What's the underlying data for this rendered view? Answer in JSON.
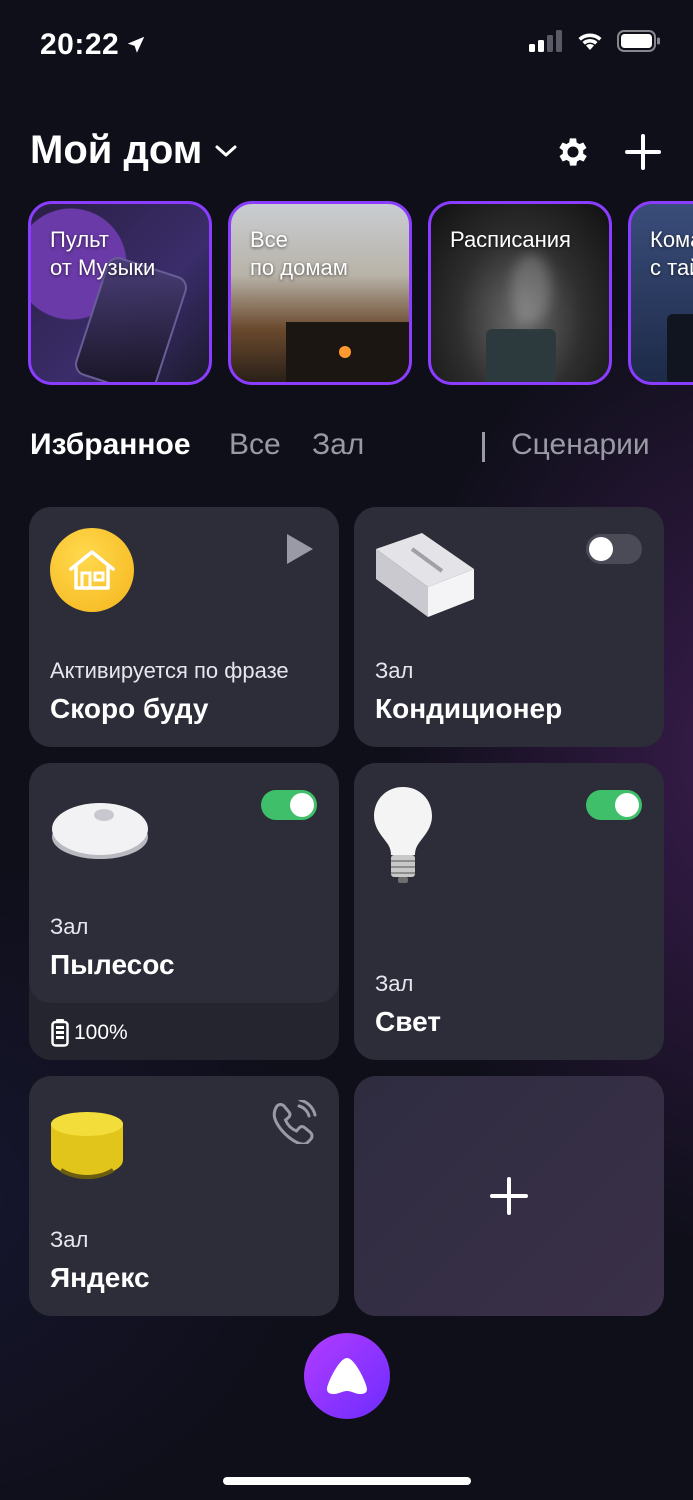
{
  "status_bar": {
    "time": "20:22"
  },
  "header": {
    "title": "Мой дом"
  },
  "stories": [
    {
      "label_line1": "Пульт",
      "label_line2": "от Музыки"
    },
    {
      "label_line1": "Все",
      "label_line2": "по домам"
    },
    {
      "label_line1": "Расписания",
      "label_line2": ""
    },
    {
      "label_line1": "Кома",
      "label_line2": "с тай"
    }
  ],
  "tabs": [
    "Избранное",
    "Все",
    "Зал",
    "Сценарии"
  ],
  "cards": {
    "scenario": {
      "subtitle": "Активируется по фразе",
      "title": "Скоро буду"
    },
    "ac": {
      "room": "Зал",
      "title": "Кондиционер",
      "toggle_on": false
    },
    "vacuum": {
      "room": "Зал",
      "title": "Пылесос",
      "battery": "100%",
      "toggle_on": true
    },
    "light": {
      "room": "Зал",
      "title": "Свет",
      "toggle_on": true
    },
    "speaker": {
      "room": "Зал",
      "title": "Яндекс"
    }
  },
  "colors": {
    "accent": "#8a3cff",
    "toggle_on": "#3fbf6a",
    "card_bg": "#2c2d38"
  },
  "icons": [
    "location-arrow-icon",
    "signal-icon",
    "wifi-icon",
    "battery-icon",
    "chevron-down-icon",
    "gear-icon",
    "plus-icon",
    "play-icon",
    "house-icon",
    "call-icon",
    "alice-icon"
  ]
}
